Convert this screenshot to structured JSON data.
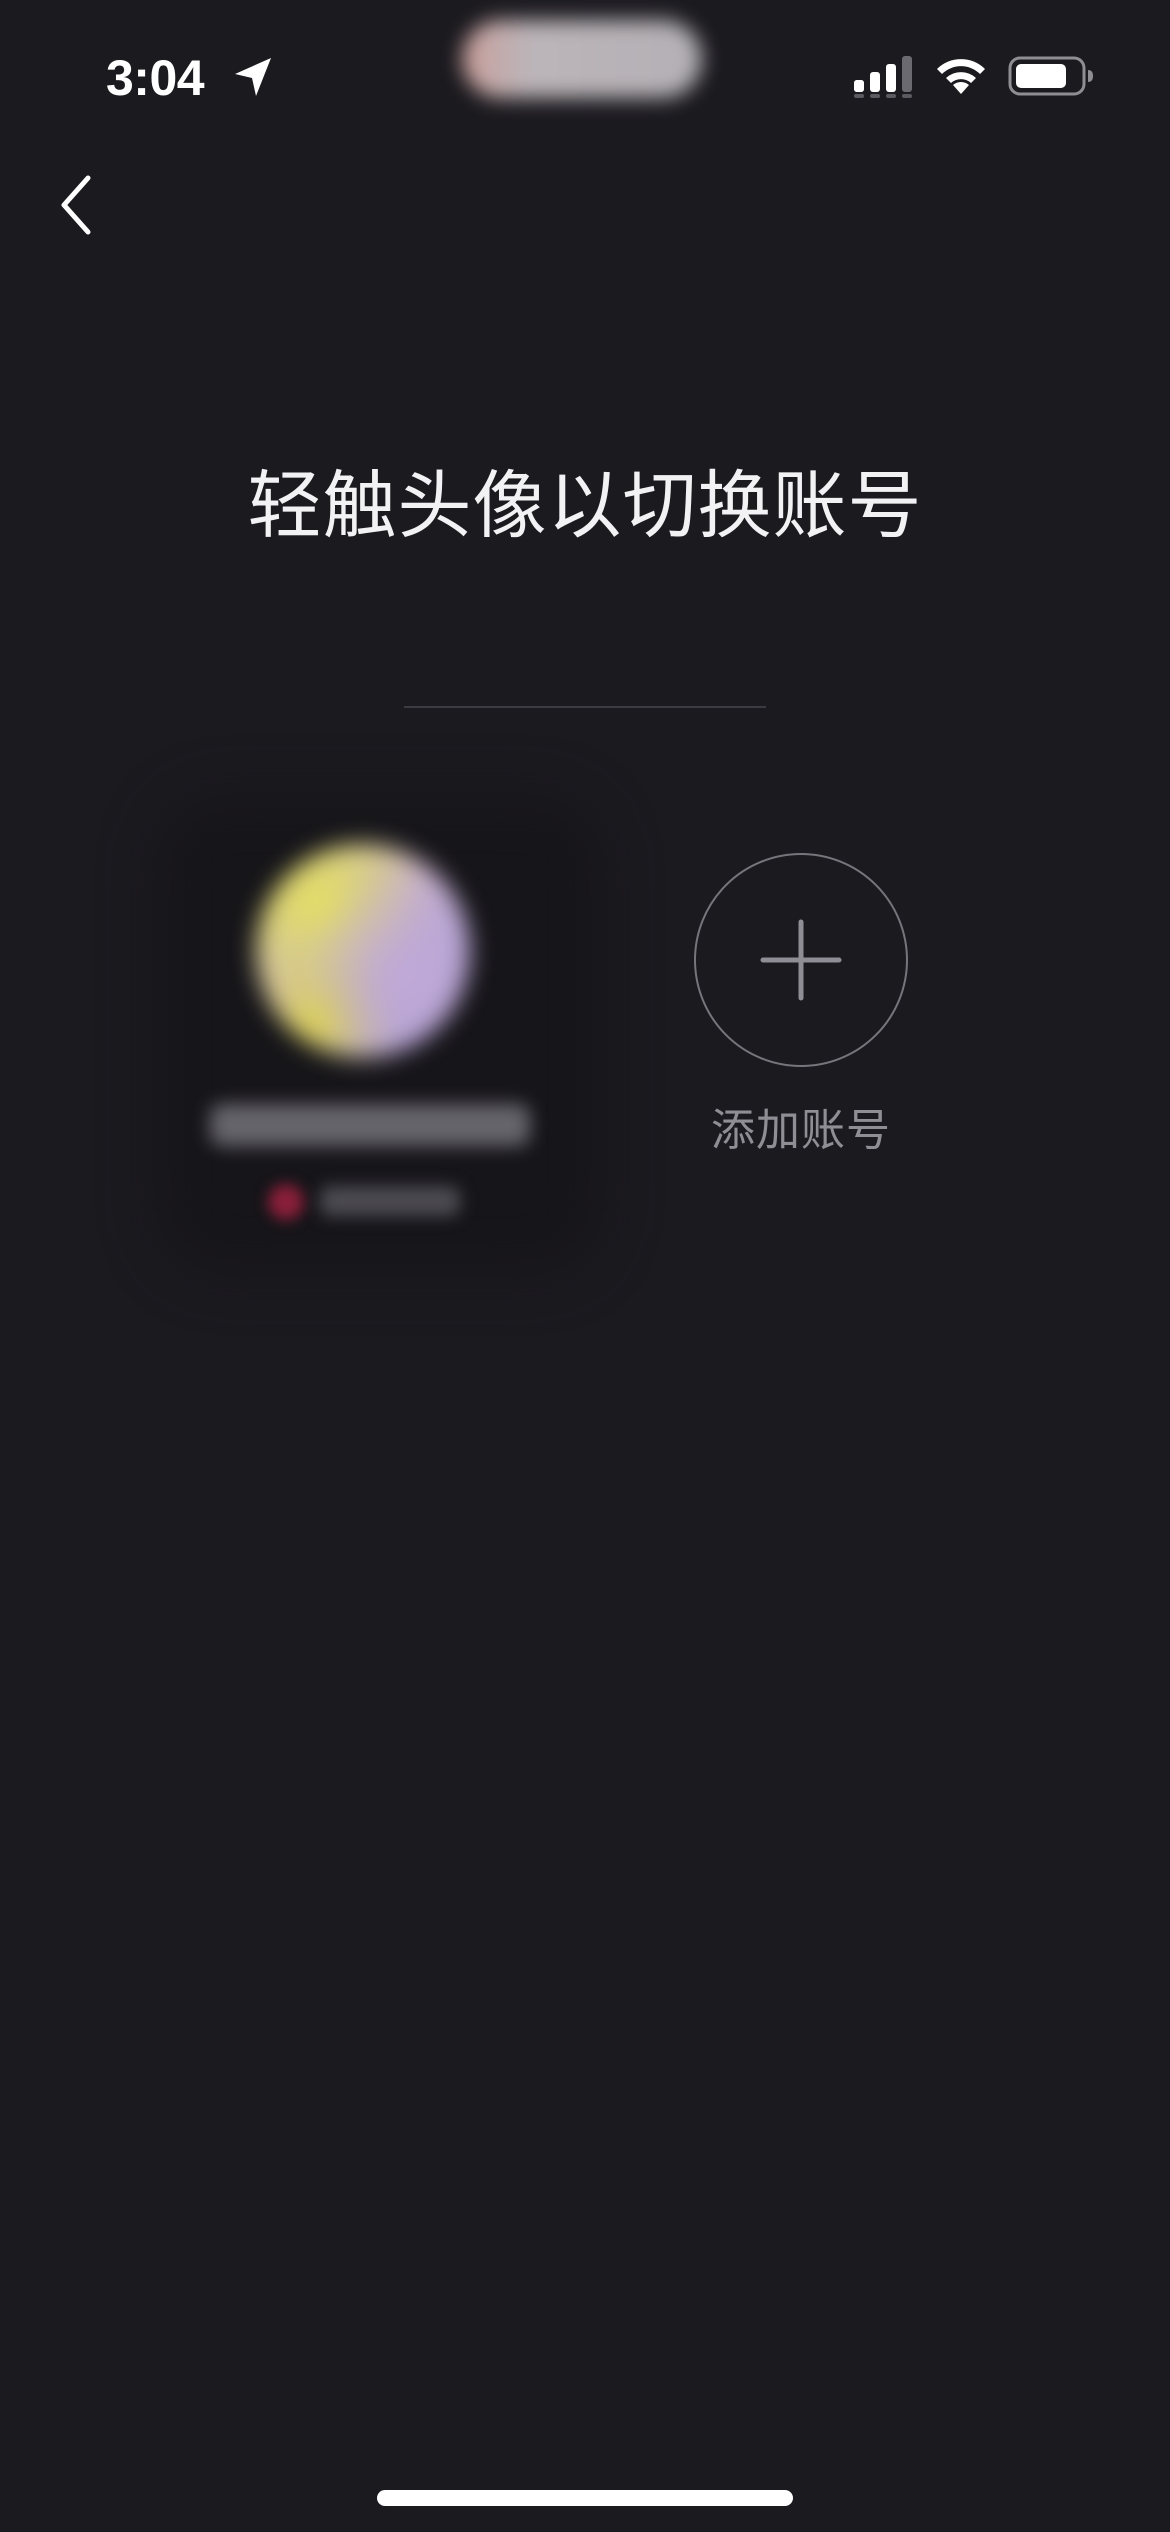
{
  "status_bar": {
    "time": "3:04",
    "location_icon": "location-arrow-icon",
    "signal_icon": "cellular-signal-icon",
    "wifi_icon": "wifi-icon",
    "battery_icon": "battery-icon"
  },
  "nav": {
    "back_icon": "chevron-left-icon"
  },
  "page": {
    "title": "轻触头像以切换账号"
  },
  "accounts": {
    "current": {
      "avatar_icon": "user-avatar"
    },
    "add": {
      "icon": "plus-icon",
      "label": "添加账号"
    }
  },
  "colors": {
    "background": "#1b1a1f",
    "title_text": "#f2f2f4",
    "secondary_text": "#8f8e94",
    "circle_border": "#76757b"
  }
}
